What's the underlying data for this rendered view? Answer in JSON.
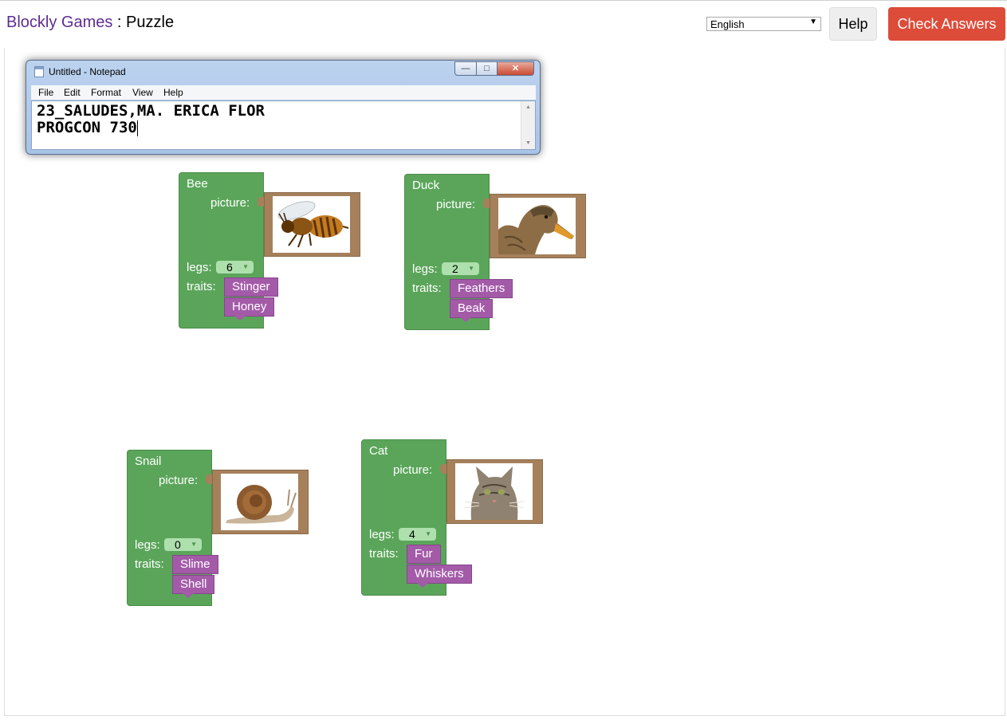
{
  "header": {
    "site_name": "Blockly Games",
    "separator": " : ",
    "page_name": "Puzzle",
    "language": "English",
    "help_label": "Help",
    "check_label": "Check Answers"
  },
  "notepad": {
    "title": "Untitled - Notepad",
    "controls": {
      "minimize": "—",
      "maximize": "□",
      "close": "✕"
    },
    "menu": [
      "File",
      "Edit",
      "Format",
      "View",
      "Help"
    ],
    "lines": [
      "23_SALUDES,MA. ERICA FLOR",
      "PROGCON 730"
    ]
  },
  "labels": {
    "picture": "picture:",
    "legs": "legs:",
    "traits": "traits:"
  },
  "animals": [
    {
      "name": "Bee",
      "legs": "6",
      "traits": [
        "Stinger",
        "Honey"
      ],
      "picture": "bee"
    },
    {
      "name": "Duck",
      "legs": "2",
      "traits": [
        "Feathers",
        "Beak"
      ],
      "picture": "duck"
    },
    {
      "name": "Snail",
      "legs": "0",
      "traits": [
        "Slime",
        "Shell"
      ],
      "picture": "snail"
    },
    {
      "name": "Cat",
      "legs": "4",
      "traits": [
        "Fur",
        "Whiskers"
      ],
      "picture": "cat"
    }
  ],
  "colors": {
    "animal_block": "#5ba55b",
    "trait_block": "#a35ba8",
    "picture_frame": "#a5805b",
    "check_button": "#dd4b39",
    "title_link": "#5e2d91"
  }
}
